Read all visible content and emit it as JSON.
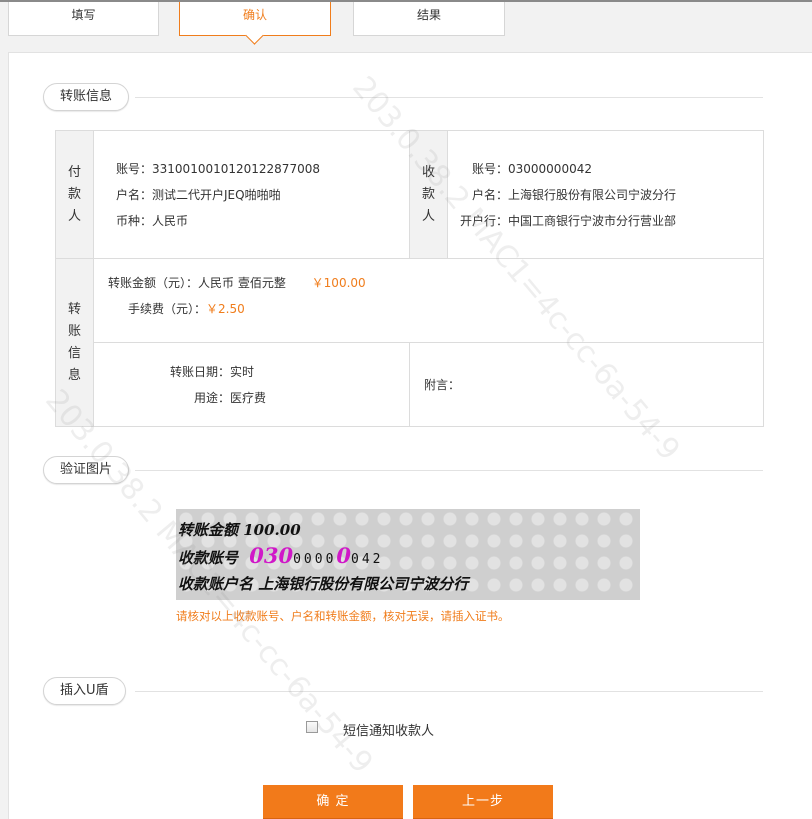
{
  "steps": [
    {
      "label": "填写",
      "active": false
    },
    {
      "label": "确认",
      "active": true
    },
    {
      "label": "结果",
      "active": false
    }
  ],
  "transfer_section": {
    "title": "转账信息",
    "payer": {
      "label_chars": [
        "付",
        "款",
        "人"
      ],
      "account_label": "账号：",
      "account": "3310010010120122877008",
      "name_label": "户名：",
      "name": "测试二代开户JEQ啪啪啪",
      "currency_label": "币种：",
      "currency": "人民币"
    },
    "payee": {
      "label_chars": [
        "收",
        "款",
        "人"
      ],
      "account_label": "账号：",
      "account": "03000000042",
      "name_label": "户名：",
      "name": "上海银行股份有限公司宁波分行",
      "bank_label": "开户行：",
      "bank": "中国工商银行宁波市分行营业部"
    },
    "details": {
      "label_chars": [
        "转",
        "账",
        "信",
        "息"
      ],
      "amount_label": "转账金额（元）：",
      "amount_words": "人民币 壹佰元整",
      "amount": "￥100.00",
      "fee_label": "手续费（元）：",
      "fee": "￥2.50",
      "date_label": "转账日期：",
      "date": "实时",
      "purpose_label": "用途：",
      "purpose": "医疗费",
      "remark_label": "附言：",
      "remark": ""
    }
  },
  "verify_section": {
    "title": "验证图片",
    "captcha": {
      "line1": "转账金额 100.00",
      "line2_label": "收款账号",
      "line2_a": "030",
      "line2_b": "0000",
      "line2_c": "0",
      "line2_d": "042",
      "line3": "收款账户名 上海银行股份有限公司宁波分行"
    },
    "notice": "请核对以上收款账号、户名和转账金额，核对无误，请插入证书。",
    "notice_color": "#f07d1c"
  },
  "ukey_section": {
    "title": "插入U盾",
    "sms_label": "短信通知收款人",
    "sms_checked": false
  },
  "buttons": {
    "confirm": "确 定",
    "previous": "上一步",
    "color": "#f27a1a"
  },
  "watermark": {
    "line_a": "203.0.38.2 MAC1=4c-cc-6a-54-9",
    "line_b": "203.0.38.2 MAC1=4c-cc-6a-54-9"
  }
}
